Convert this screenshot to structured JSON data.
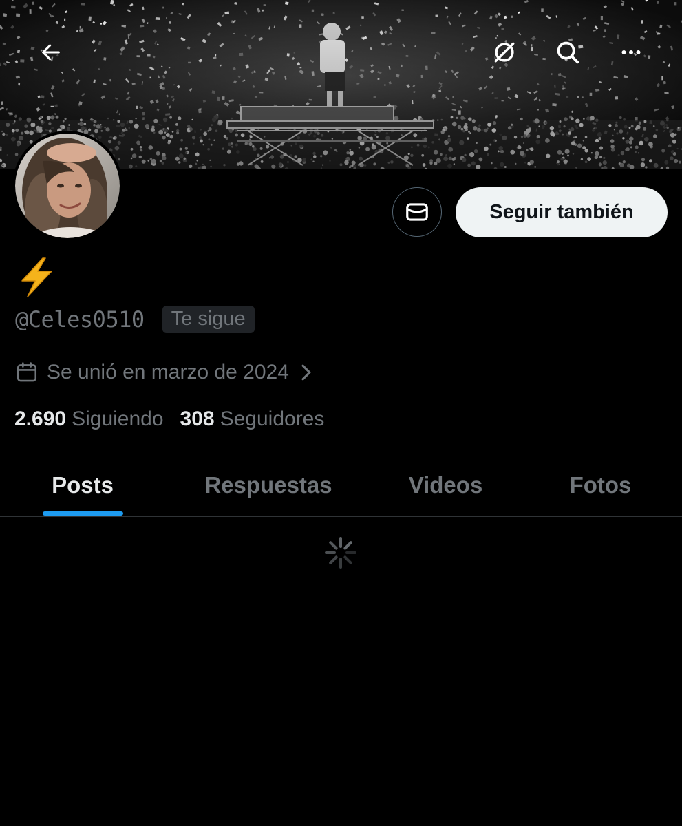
{
  "header": {
    "back_icon": "arrow-left-icon",
    "grok_icon": "grok-icon",
    "search_icon": "search-icon",
    "more_icon": "more-horizontal-icon"
  },
  "profile": {
    "display_name_icon": "lightning-bolt-emoji",
    "handle": "@Celes0510",
    "follows_you_badge": "Te sigue",
    "joined_text": "Se unió en marzo de 2024",
    "following_count": "2.690",
    "following_label": "Siguiendo",
    "followers_count": "308",
    "followers_label": "Seguidores"
  },
  "actions": {
    "message_icon": "envelope-icon",
    "follow_label": "Seguir también"
  },
  "tabs": [
    {
      "label": "Posts",
      "active": true
    },
    {
      "label": "Respuestas",
      "active": false
    },
    {
      "label": "Videos",
      "active": false
    },
    {
      "label": "Fotos",
      "active": false
    }
  ],
  "colors": {
    "background": "#000000",
    "accent": "#1d9bf0",
    "secondary_text": "#71767b",
    "follow_button_bg": "#eff3f4"
  }
}
